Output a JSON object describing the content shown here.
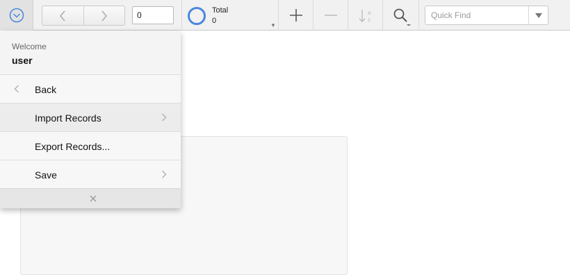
{
  "toolbar": {
    "record_number": "0",
    "total_label": "Total",
    "total_value": "0",
    "quick_find_placeholder": "Quick Find"
  },
  "menu": {
    "welcome_label": "Welcome",
    "username": "user",
    "items": [
      {
        "label": "Back",
        "icon": "chevron-left-icon"
      },
      {
        "label": "Import Records",
        "icon": "chevron-right-icon"
      },
      {
        "label": "Export Records...",
        "icon": ""
      },
      {
        "label": "Save",
        "icon": "chevron-right-icon"
      }
    ],
    "close_icon": "close-icon"
  },
  "colors": {
    "accent": "#4a86de",
    "toolbar_bg": "#f1f1f1",
    "menu_bg": "#f4f4f4"
  }
}
